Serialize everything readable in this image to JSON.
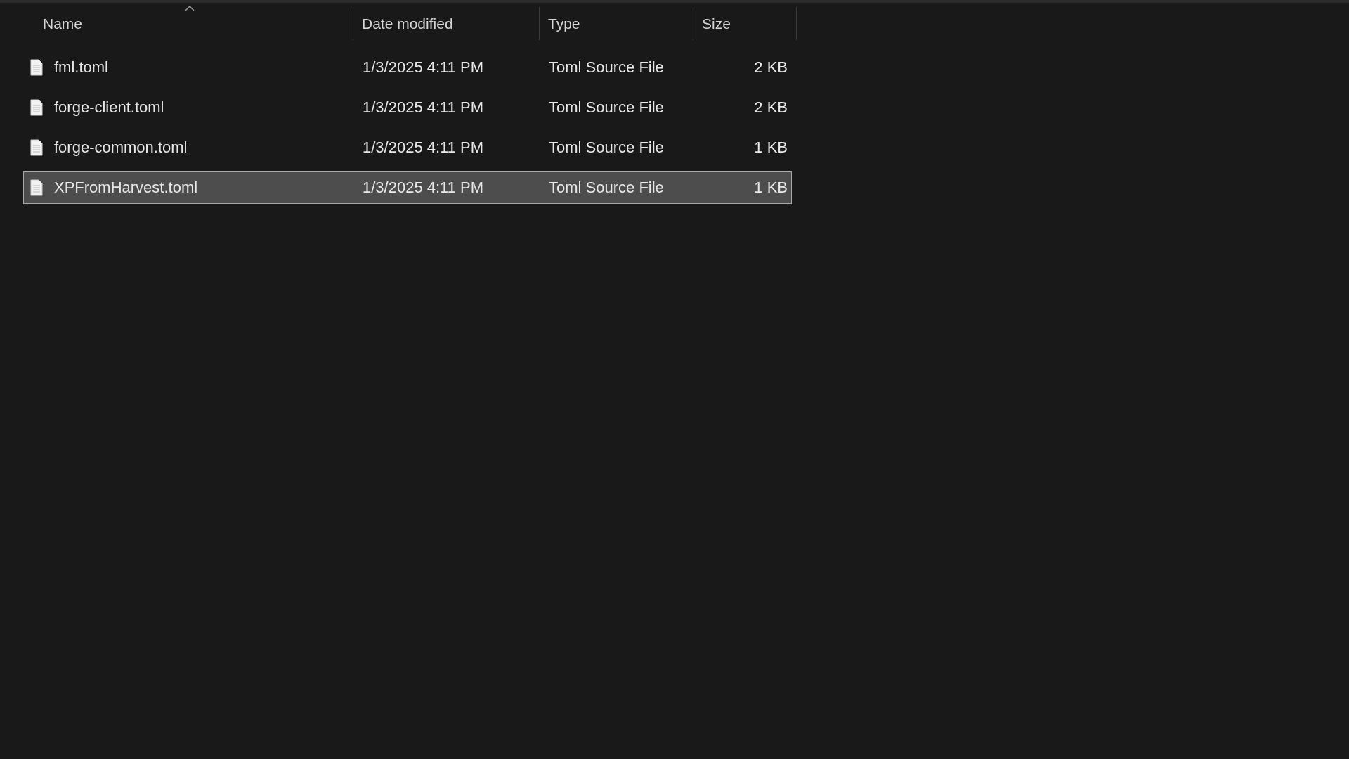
{
  "columns": [
    {
      "label": "Name",
      "sorted": true
    },
    {
      "label": "Date modified",
      "sorted": false
    },
    {
      "label": "Type",
      "sorted": false
    },
    {
      "label": "Size",
      "sorted": false
    }
  ],
  "files": [
    {
      "name": "fml.toml",
      "date_modified": "1/3/2025 4:11 PM",
      "type": "Toml Source File",
      "size": "2 KB",
      "selected": false
    },
    {
      "name": "forge-client.toml",
      "date_modified": "1/3/2025 4:11 PM",
      "type": "Toml Source File",
      "size": "2 KB",
      "selected": false
    },
    {
      "name": "forge-common.toml",
      "date_modified": "1/3/2025 4:11 PM",
      "type": "Toml Source File",
      "size": "1 KB",
      "selected": false
    },
    {
      "name": "XPFromHarvest.toml",
      "date_modified": "1/3/2025 4:11 PM",
      "type": "Toml Source File",
      "size": "1 KB",
      "selected": true
    }
  ]
}
